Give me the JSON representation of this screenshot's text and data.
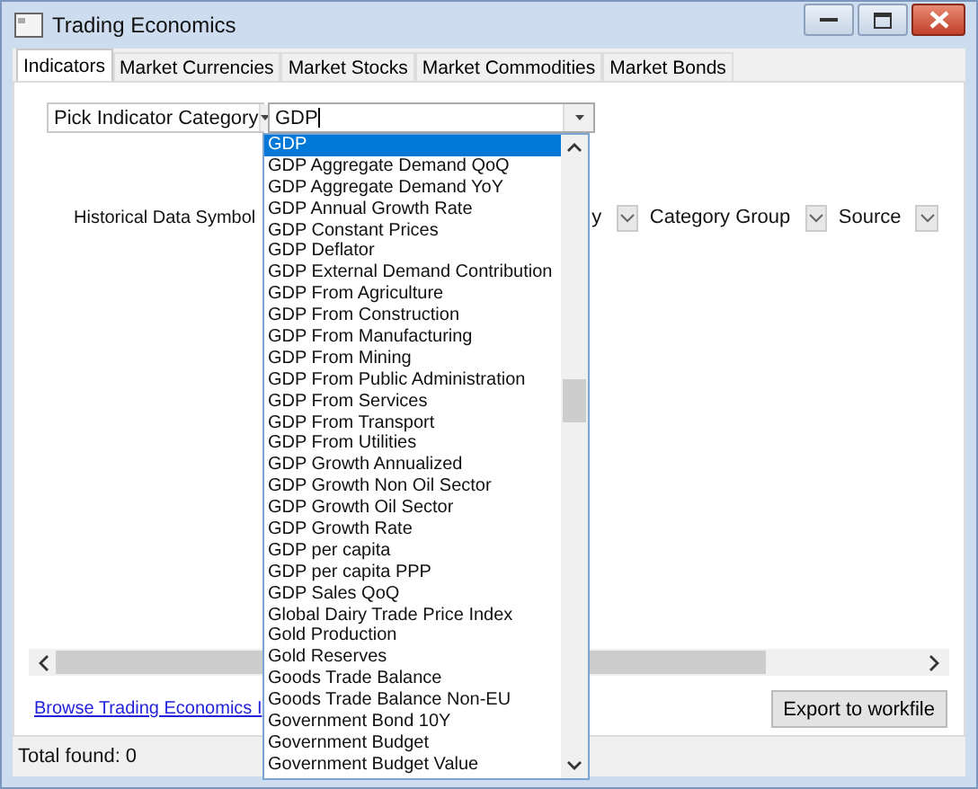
{
  "window": {
    "title": "Trading Economics"
  },
  "tabs": [
    {
      "label": "Indicators",
      "selected": true
    },
    {
      "label": "Market Currencies",
      "selected": false
    },
    {
      "label": "Market Stocks",
      "selected": false
    },
    {
      "label": "Market Commodities",
      "selected": false
    },
    {
      "label": "Market Bonds",
      "selected": false
    }
  ],
  "category_combo": {
    "value": "Pick Indicator Category"
  },
  "indicator_combo": {
    "value": "GDP"
  },
  "indicator_list": [
    {
      "label": "GDP",
      "selected": true
    },
    {
      "label": "GDP Aggregate Demand QoQ",
      "selected": false
    },
    {
      "label": "GDP Aggregate Demand YoY",
      "selected": false
    },
    {
      "label": "GDP Annual Growth Rate",
      "selected": false
    },
    {
      "label": "GDP Constant Prices",
      "selected": false
    },
    {
      "label": "GDP Deflator",
      "selected": false
    },
    {
      "label": "GDP External Demand Contribution",
      "selected": false
    },
    {
      "label": "GDP From Agriculture",
      "selected": false
    },
    {
      "label": "GDP From Construction",
      "selected": false
    },
    {
      "label": "GDP From Manufacturing",
      "selected": false
    },
    {
      "label": "GDP From Mining",
      "selected": false
    },
    {
      "label": "GDP From Public Administration",
      "selected": false
    },
    {
      "label": "GDP From Services",
      "selected": false
    },
    {
      "label": "GDP From Transport",
      "selected": false
    },
    {
      "label": "GDP From Utilities",
      "selected": false
    },
    {
      "label": "GDP Growth Annualized",
      "selected": false
    },
    {
      "label": "GDP Growth Non Oil Sector",
      "selected": false
    },
    {
      "label": "GDP Growth Oil Sector",
      "selected": false
    },
    {
      "label": "GDP Growth Rate",
      "selected": false
    },
    {
      "label": "GDP per capita",
      "selected": false
    },
    {
      "label": "GDP per capita PPP",
      "selected": false
    },
    {
      "label": "GDP Sales QoQ",
      "selected": false
    },
    {
      "label": "Global Dairy Trade Price Index",
      "selected": false
    },
    {
      "label": "Gold Production",
      "selected": false
    },
    {
      "label": "Gold Reserves",
      "selected": false
    },
    {
      "label": "Goods Trade Balance",
      "selected": false
    },
    {
      "label": "Goods Trade Balance Non-EU",
      "selected": false
    },
    {
      "label": "Government Bond 10Y",
      "selected": false
    },
    {
      "label": "Government Budget",
      "selected": false
    },
    {
      "label": "Government Budget Value",
      "selected": false
    }
  ],
  "filters": {
    "symbol_label": "Historical Data Symbol",
    "hidden_label_tail": "y",
    "category_group_label": "Category Group",
    "source_label": "Source"
  },
  "link": "Browse Trading Economics I",
  "export_button": "Export to workfile",
  "status_bar": "Total found: 0"
}
